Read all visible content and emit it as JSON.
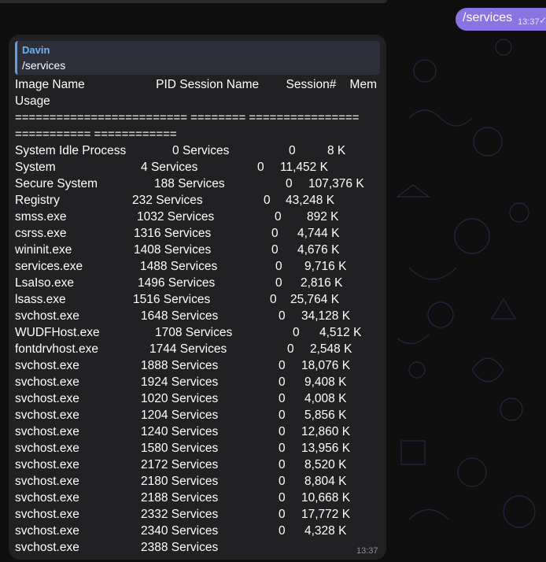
{
  "outgoing": {
    "text": "/services",
    "time": "13:37"
  },
  "reply": {
    "author": "Davin",
    "text": "/services"
  },
  "header": {
    "line1": "Image Name                     PID Session Name        Session#    Mem",
    "line2": "Usage",
    "line3": "========================= ======== ================",
    "line4": "=========== ============"
  },
  "processes": [
    {
      "name": "System Idle Process",
      "pid": "0",
      "session": "Services",
      "num": "0",
      "mem": "8 K"
    },
    {
      "name": "System",
      "pid": "4",
      "session": "Services",
      "num": "0",
      "mem": "11,452 K"
    },
    {
      "name": "Secure System",
      "pid": "188",
      "session": "Services",
      "num": "0",
      "mem": "107,376 K"
    },
    {
      "name": "Registry",
      "pid": "232",
      "session": "Services",
      "num": "0",
      "mem": "43,248 K"
    },
    {
      "name": "smss.exe",
      "pid": "1032",
      "session": "Services",
      "num": "0",
      "mem": "892 K"
    },
    {
      "name": "csrss.exe",
      "pid": "1316",
      "session": "Services",
      "num": "0",
      "mem": "4,744 K"
    },
    {
      "name": "wininit.exe",
      "pid": "1408",
      "session": "Services",
      "num": "0",
      "mem": "4,676 K"
    },
    {
      "name": "services.exe",
      "pid": "1488",
      "session": "Services",
      "num": "0",
      "mem": "9,716 K"
    },
    {
      "name": "LsaIso.exe",
      "pid": "1496",
      "session": "Services",
      "num": "0",
      "mem": "2,816 K"
    },
    {
      "name": "lsass.exe",
      "pid": "1516",
      "session": "Services",
      "num": "0",
      "mem": "25,764 K"
    },
    {
      "name": "svchost.exe",
      "pid": "1648",
      "session": "Services",
      "num": "0",
      "mem": "34,128 K"
    },
    {
      "name": "WUDFHost.exe",
      "pid": "1708",
      "session": "Services",
      "num": "0",
      "mem": "4,512 K"
    },
    {
      "name": "fontdrvhost.exe",
      "pid": "1744",
      "session": "Services",
      "num": "0",
      "mem": "2,548 K"
    },
    {
      "name": "svchost.exe",
      "pid": "1888",
      "session": "Services",
      "num": "0",
      "mem": "18,076 K"
    },
    {
      "name": "svchost.exe",
      "pid": "1924",
      "session": "Services",
      "num": "0",
      "mem": "9,408 K"
    },
    {
      "name": "svchost.exe",
      "pid": "1020",
      "session": "Services",
      "num": "0",
      "mem": "4,008 K"
    },
    {
      "name": "svchost.exe",
      "pid": "1204",
      "session": "Services",
      "num": "0",
      "mem": "5,856 K"
    },
    {
      "name": "svchost.exe",
      "pid": "1240",
      "session": "Services",
      "num": "0",
      "mem": "12,860 K"
    },
    {
      "name": "svchost.exe",
      "pid": "1580",
      "session": "Services",
      "num": "0",
      "mem": "13,956 K"
    },
    {
      "name": "svchost.exe",
      "pid": "2172",
      "session": "Services",
      "num": "0",
      "mem": "8,520 K"
    },
    {
      "name": "svchost.exe",
      "pid": "2180",
      "session": "Services",
      "num": "0",
      "mem": "8,804 K"
    },
    {
      "name": "svchost.exe",
      "pid": "2188",
      "session": "Services",
      "num": "0",
      "mem": "10,668 K"
    },
    {
      "name": "svchost.exe",
      "pid": "2332",
      "session": "Services",
      "num": "0",
      "mem": "17,772 K"
    },
    {
      "name": "svchost.exe",
      "pid": "2340",
      "session": "Services",
      "num": "0",
      "mem": "4,328 K"
    },
    {
      "name": "svchost.exe",
      "pid": "2388",
      "session": "Services",
      "num": "",
      "mem": ""
    }
  ],
  "message_time": "13:37",
  "colors": {
    "accent": "#8a74e3",
    "bubble": "#212123",
    "reply_bar": "#5c9ee8"
  }
}
